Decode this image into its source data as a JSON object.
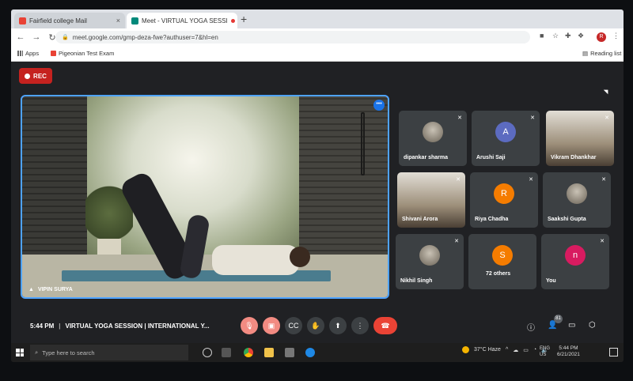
{
  "browser": {
    "tabs": [
      {
        "title": "Fairfield college Mail",
        "close": "×"
      },
      {
        "title": "Meet - VIRTUAL YOGA SESSI",
        "close": "×"
      }
    ],
    "new_tab": "+",
    "url": "meet.google.com/gmp-deza-fwe?authuser=7&hl=en",
    "profile_initial": "R",
    "bookmarks": [
      {
        "label": "Apps"
      },
      {
        "label": "Pigeonian Test Exam"
      }
    ],
    "reading_list": "Reading list"
  },
  "meet": {
    "rec_label": "REC",
    "main_speaker": {
      "name": "VIPIN SURYA"
    },
    "main_more": "•••",
    "participants": [
      {
        "name": "dipankar sharma",
        "initial": "",
        "color": "#6d4c41",
        "photo": true,
        "video": false
      },
      {
        "name": "Arushi Saji",
        "initial": "A",
        "color": "#5c6bc0",
        "photo": false,
        "video": false
      },
      {
        "name": "Vikram Dhankhar",
        "initial": "",
        "color": "",
        "photo": false,
        "video": true
      },
      {
        "name": "Shivani Arora",
        "initial": "",
        "color": "",
        "photo": false,
        "video": true
      },
      {
        "name": "Riya Chadha",
        "initial": "R",
        "color": "#f57c00",
        "photo": false,
        "video": false
      },
      {
        "name": "Saakshi Gupta",
        "initial": "",
        "color": "#8d6e63",
        "photo": true,
        "video": false
      },
      {
        "name": "Nikhil Singh",
        "initial": "",
        "color": "#546e7a",
        "photo": true,
        "video": false
      },
      {
        "name": "72 others",
        "initial": "S",
        "color": "#f57c00",
        "photo": false,
        "video": false
      },
      {
        "name": "You",
        "initial": "n",
        "color": "#d81b60",
        "photo": false,
        "video": false
      }
    ],
    "time": "5:44 PM",
    "meeting_title": "VIRTUAL YOGA SESSION | INTERNATIONAL Y...",
    "participant_count": "81"
  },
  "taskbar": {
    "search_placeholder": "Type here to search",
    "weather": "37°C  Haze",
    "lang": "ENG\nUS",
    "clock_time": "5:44 PM",
    "clock_date": "6/21/2021"
  },
  "colors": {
    "accent": "#1a73e8",
    "rec": "#c5221f",
    "hangup": "#ea4335",
    "meet_bg": "#202124"
  }
}
